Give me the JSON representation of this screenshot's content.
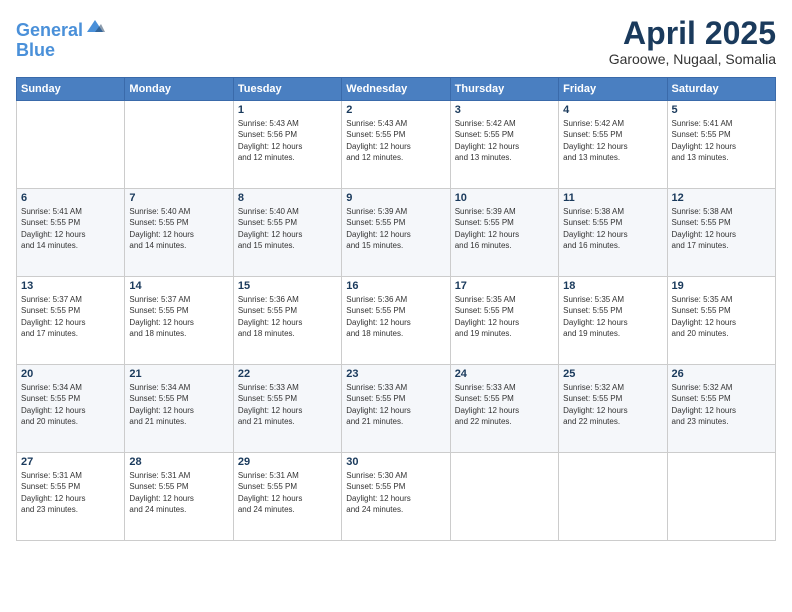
{
  "logo": {
    "line1": "General",
    "line2": "Blue"
  },
  "title": "April 2025",
  "subtitle": "Garoowe, Nugaal, Somalia",
  "weekdays": [
    "Sunday",
    "Monday",
    "Tuesday",
    "Wednesday",
    "Thursday",
    "Friday",
    "Saturday"
  ],
  "weeks": [
    [
      {
        "day": "",
        "info": ""
      },
      {
        "day": "",
        "info": ""
      },
      {
        "day": "1",
        "info": "Sunrise: 5:43 AM\nSunset: 5:56 PM\nDaylight: 12 hours\nand 12 minutes."
      },
      {
        "day": "2",
        "info": "Sunrise: 5:43 AM\nSunset: 5:55 PM\nDaylight: 12 hours\nand 12 minutes."
      },
      {
        "day": "3",
        "info": "Sunrise: 5:42 AM\nSunset: 5:55 PM\nDaylight: 12 hours\nand 13 minutes."
      },
      {
        "day": "4",
        "info": "Sunrise: 5:42 AM\nSunset: 5:55 PM\nDaylight: 12 hours\nand 13 minutes."
      },
      {
        "day": "5",
        "info": "Sunrise: 5:41 AM\nSunset: 5:55 PM\nDaylight: 12 hours\nand 13 minutes."
      }
    ],
    [
      {
        "day": "6",
        "info": "Sunrise: 5:41 AM\nSunset: 5:55 PM\nDaylight: 12 hours\nand 14 minutes."
      },
      {
        "day": "7",
        "info": "Sunrise: 5:40 AM\nSunset: 5:55 PM\nDaylight: 12 hours\nand 14 minutes."
      },
      {
        "day": "8",
        "info": "Sunrise: 5:40 AM\nSunset: 5:55 PM\nDaylight: 12 hours\nand 15 minutes."
      },
      {
        "day": "9",
        "info": "Sunrise: 5:39 AM\nSunset: 5:55 PM\nDaylight: 12 hours\nand 15 minutes."
      },
      {
        "day": "10",
        "info": "Sunrise: 5:39 AM\nSunset: 5:55 PM\nDaylight: 12 hours\nand 16 minutes."
      },
      {
        "day": "11",
        "info": "Sunrise: 5:38 AM\nSunset: 5:55 PM\nDaylight: 12 hours\nand 16 minutes."
      },
      {
        "day": "12",
        "info": "Sunrise: 5:38 AM\nSunset: 5:55 PM\nDaylight: 12 hours\nand 17 minutes."
      }
    ],
    [
      {
        "day": "13",
        "info": "Sunrise: 5:37 AM\nSunset: 5:55 PM\nDaylight: 12 hours\nand 17 minutes."
      },
      {
        "day": "14",
        "info": "Sunrise: 5:37 AM\nSunset: 5:55 PM\nDaylight: 12 hours\nand 18 minutes."
      },
      {
        "day": "15",
        "info": "Sunrise: 5:36 AM\nSunset: 5:55 PM\nDaylight: 12 hours\nand 18 minutes."
      },
      {
        "day": "16",
        "info": "Sunrise: 5:36 AM\nSunset: 5:55 PM\nDaylight: 12 hours\nand 18 minutes."
      },
      {
        "day": "17",
        "info": "Sunrise: 5:35 AM\nSunset: 5:55 PM\nDaylight: 12 hours\nand 19 minutes."
      },
      {
        "day": "18",
        "info": "Sunrise: 5:35 AM\nSunset: 5:55 PM\nDaylight: 12 hours\nand 19 minutes."
      },
      {
        "day": "19",
        "info": "Sunrise: 5:35 AM\nSunset: 5:55 PM\nDaylight: 12 hours\nand 20 minutes."
      }
    ],
    [
      {
        "day": "20",
        "info": "Sunrise: 5:34 AM\nSunset: 5:55 PM\nDaylight: 12 hours\nand 20 minutes."
      },
      {
        "day": "21",
        "info": "Sunrise: 5:34 AM\nSunset: 5:55 PM\nDaylight: 12 hours\nand 21 minutes."
      },
      {
        "day": "22",
        "info": "Sunrise: 5:33 AM\nSunset: 5:55 PM\nDaylight: 12 hours\nand 21 minutes."
      },
      {
        "day": "23",
        "info": "Sunrise: 5:33 AM\nSunset: 5:55 PM\nDaylight: 12 hours\nand 21 minutes."
      },
      {
        "day": "24",
        "info": "Sunrise: 5:33 AM\nSunset: 5:55 PM\nDaylight: 12 hours\nand 22 minutes."
      },
      {
        "day": "25",
        "info": "Sunrise: 5:32 AM\nSunset: 5:55 PM\nDaylight: 12 hours\nand 22 minutes."
      },
      {
        "day": "26",
        "info": "Sunrise: 5:32 AM\nSunset: 5:55 PM\nDaylight: 12 hours\nand 23 minutes."
      }
    ],
    [
      {
        "day": "27",
        "info": "Sunrise: 5:31 AM\nSunset: 5:55 PM\nDaylight: 12 hours\nand 23 minutes."
      },
      {
        "day": "28",
        "info": "Sunrise: 5:31 AM\nSunset: 5:55 PM\nDaylight: 12 hours\nand 24 minutes."
      },
      {
        "day": "29",
        "info": "Sunrise: 5:31 AM\nSunset: 5:55 PM\nDaylight: 12 hours\nand 24 minutes."
      },
      {
        "day": "30",
        "info": "Sunrise: 5:30 AM\nSunset: 5:55 PM\nDaylight: 12 hours\nand 24 minutes."
      },
      {
        "day": "",
        "info": ""
      },
      {
        "day": "",
        "info": ""
      },
      {
        "day": "",
        "info": ""
      }
    ]
  ]
}
